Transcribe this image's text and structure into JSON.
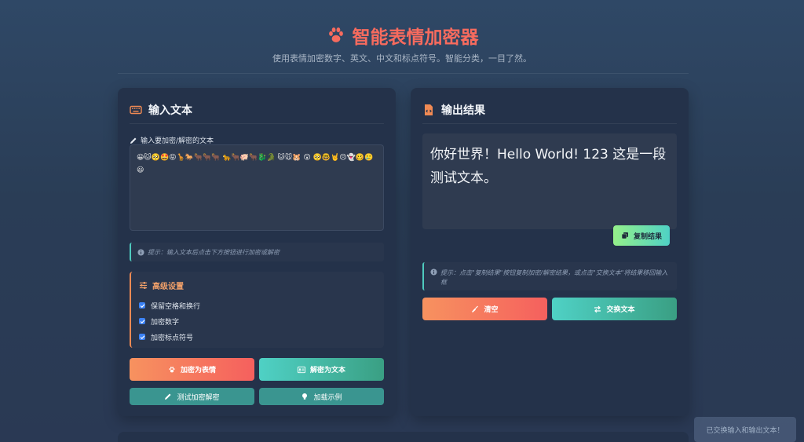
{
  "header": {
    "title": "智能表情加密器",
    "subtitle": "使用表情加密数字、英文、中文和标点符号。智能分类，一目了然。"
  },
  "input_panel": {
    "title": "输入文本",
    "field_label": "输入要加密/解密的文本",
    "textarea_value": "😀🐱🥺🤩😝🦒🐎🐂🐂🐂 🐆🐂🐖🐂🐉🐊 🐱🐭🐹 😲 🥺🤓🤘😣👻🥴🥲😃",
    "hint": "提示：输入文本后点击下方按钮进行加密或解密",
    "settings": {
      "title": "高级设置",
      "options": [
        {
          "label": "保留空格和换行",
          "checked": true
        },
        {
          "label": "加密数字",
          "checked": true
        },
        {
          "label": "加密标点符号",
          "checked": true
        }
      ]
    },
    "buttons": {
      "encrypt": "加密为表情",
      "decrypt": "解密为文本",
      "test": "测试加密解密",
      "example": "加载示例"
    }
  },
  "output_panel": {
    "title": "输出结果",
    "result": "你好世界！Hello World! 123 这是一段测试文本。",
    "copy_button": "复制结果",
    "hint": "提示：点击\"复制结果\"按钮复制加密/解密结果，或点击\"交换文本\"将结果移回输入框",
    "buttons": {
      "clear": "清空",
      "swap": "交换文本"
    }
  },
  "toast": "已交换输入和输出文本！",
  "colors": {
    "accent_red": "#f76b5e",
    "accent_teal": "#4fd1c5",
    "accent_orange": "#f08a54",
    "panel_bg": "#24324a"
  },
  "icons": {
    "title": "paw-icon",
    "input_head": "keyboard-icon",
    "output_head": "file-code-icon",
    "field_label": "pencil-icon",
    "hint": "info-icon",
    "settings": "sliders-icon"
  }
}
